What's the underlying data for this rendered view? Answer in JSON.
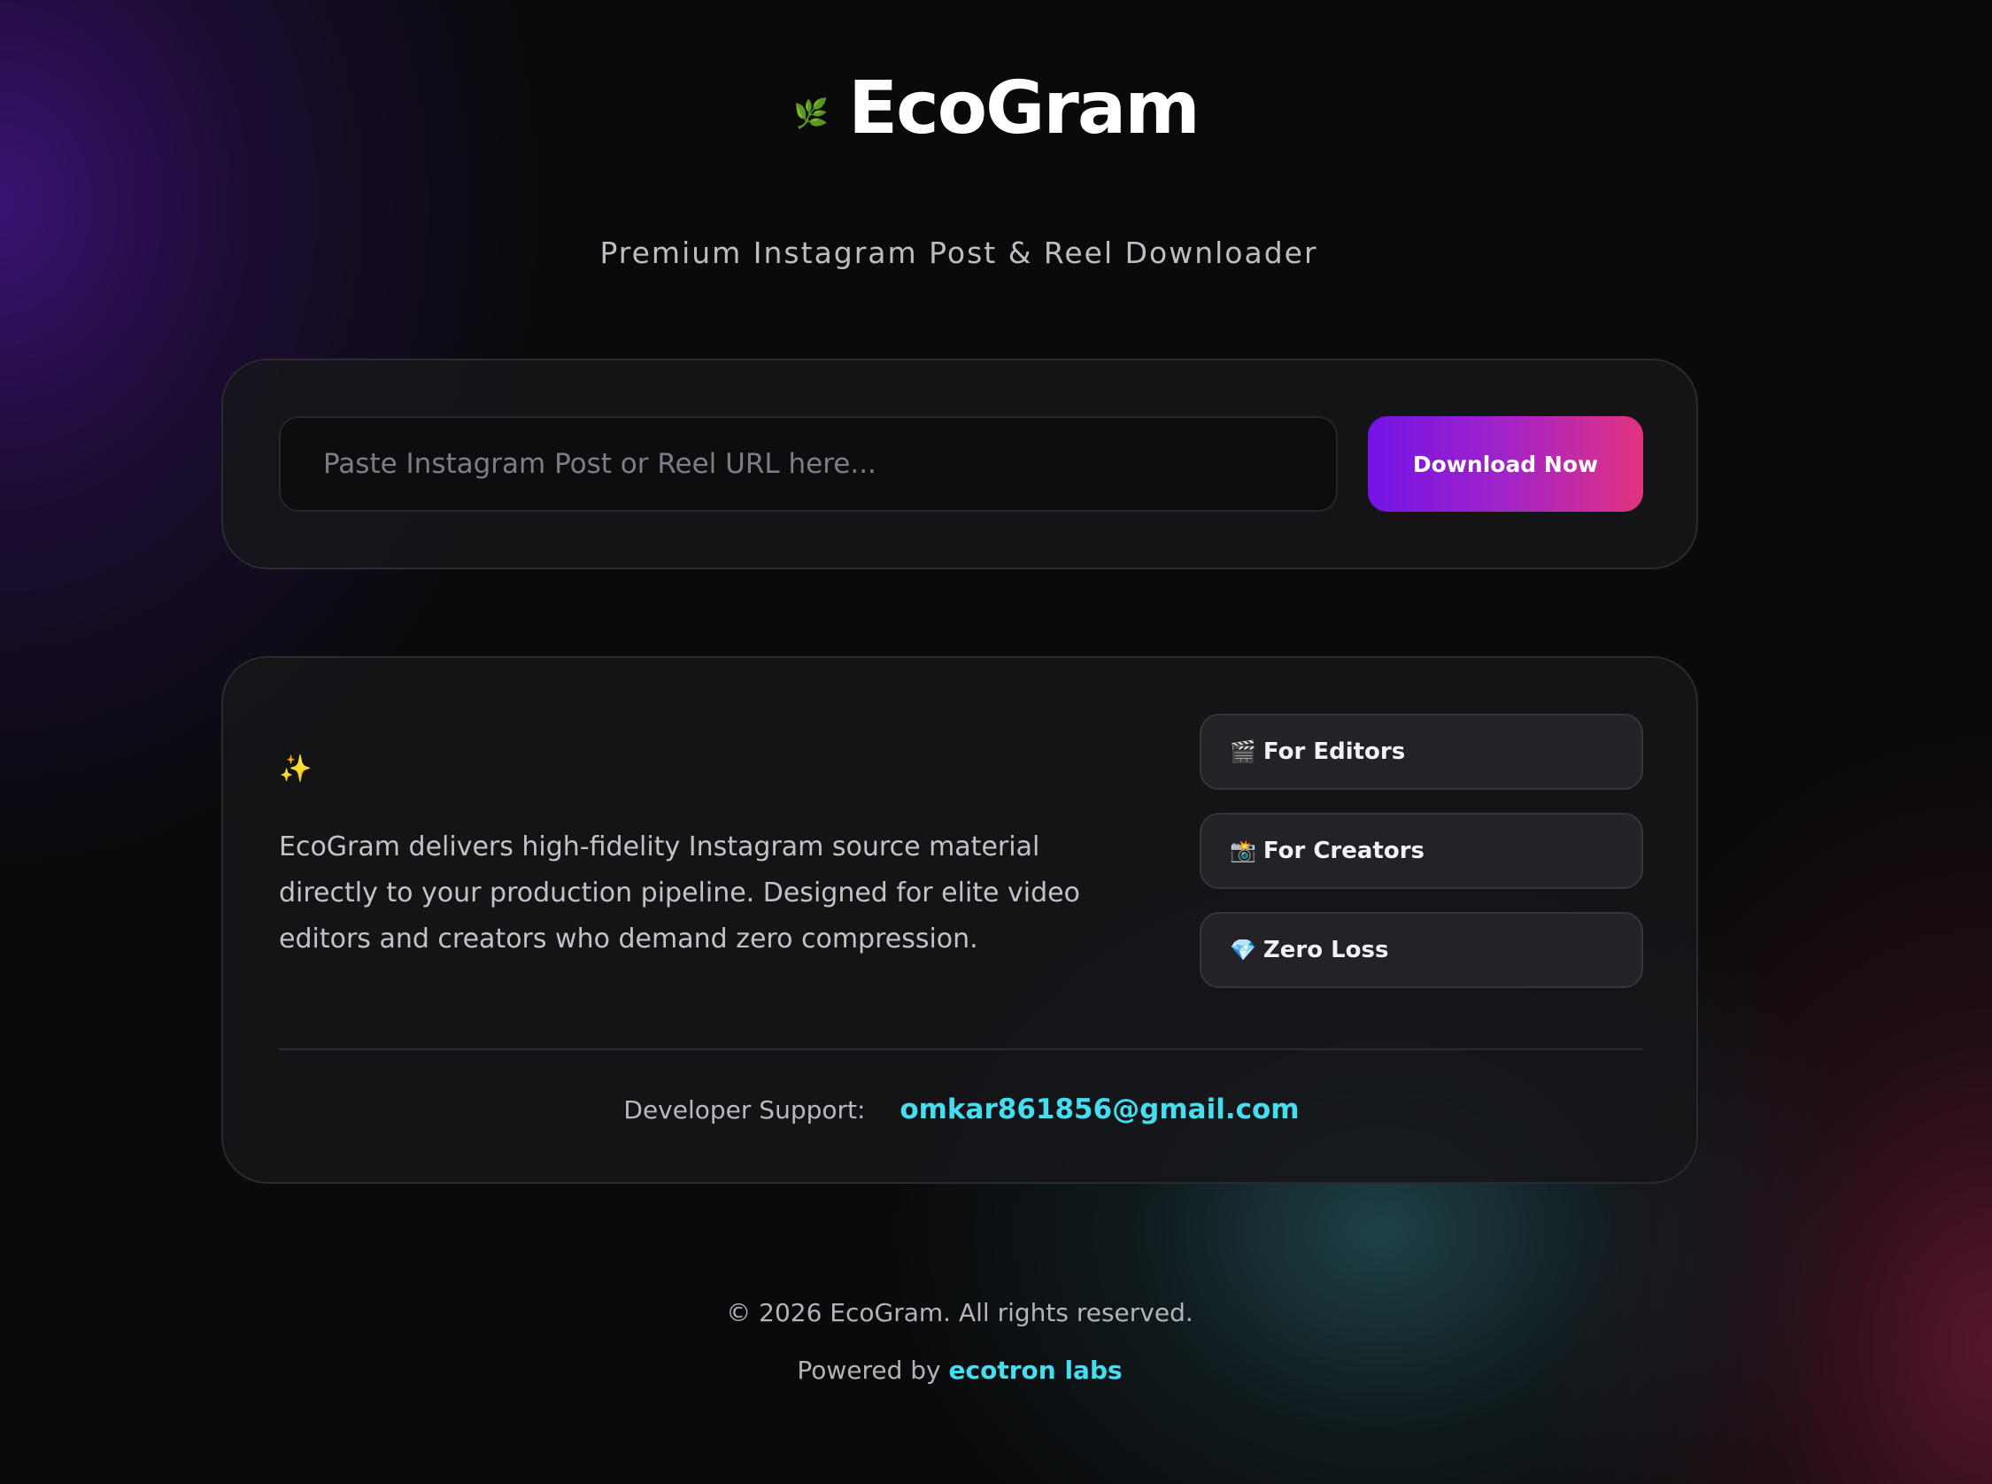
{
  "brand": {
    "icon": "leaf-icon",
    "icon_glyph": "🌿",
    "title": "EcoGram"
  },
  "subtitle": "Premium Instagram Post & Reel Downloader",
  "download": {
    "input_value": "",
    "input_placeholder": "Paste Instagram Post or Reel URL here...",
    "button_label": "Download Now"
  },
  "info": {
    "sparkle_icon": "sparkles-icon",
    "sparkle_glyph": "✨",
    "description": "EcoGram delivers high-fidelity Instagram source material directly to your production pipeline. Designed for elite video editors and creators who demand zero compression.",
    "features": [
      {
        "icon": "clapperboard-icon",
        "glyph": "🎬",
        "label": "For Editors"
      },
      {
        "icon": "camera-flash-icon",
        "glyph": "📸",
        "label": "For Creators"
      },
      {
        "icon": "gem-icon",
        "glyph": "💎",
        "label": "Zero Loss"
      }
    ],
    "support_label": "Developer Support:",
    "support_email": "omkar861856@gmail.com"
  },
  "footer": {
    "copyright": "© 2026 EcoGram. All rights reserved.",
    "powered_prefix": "Powered by",
    "powered_link": "ecotron labs"
  },
  "colors": {
    "background": "#0a0a0b",
    "accent_cyan": "#46ddf0",
    "button_gradient_start": "#7214e6",
    "button_gradient_end": "#e2327e"
  }
}
